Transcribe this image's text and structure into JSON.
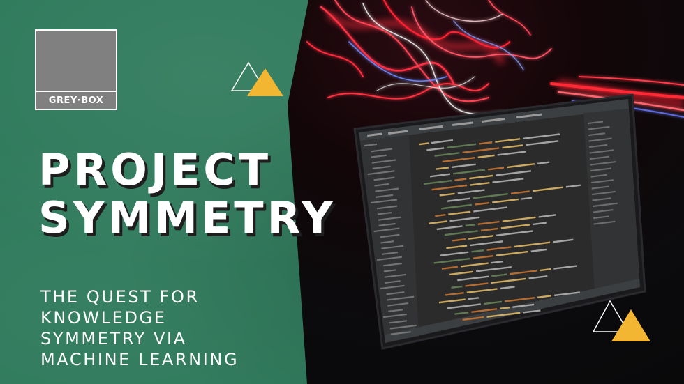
{
  "logo": {
    "text": "GREY·BOX",
    "box_color": "#808080",
    "border_color": "#ffffff"
  },
  "title": {
    "line1": "PROJECT",
    "line2": "SYMMETRY"
  },
  "subtitle": {
    "line1": "THE QUEST FOR",
    "line2": "KNOWLEDGE",
    "line3": "SYMMETRY VIA",
    "line4": "MACHINE LEARNING"
  },
  "colors": {
    "green_panel": "#2f7a5c",
    "accent_yellow": "#f2b632",
    "title_shadow": "#1e1e1e",
    "code_tag": "#e8bf6a",
    "code_attr": "#bababa",
    "code_string": "#6a8759"
  },
  "icons": [
    "triangle-outline-icon",
    "triangle-filled-icon"
  ]
}
